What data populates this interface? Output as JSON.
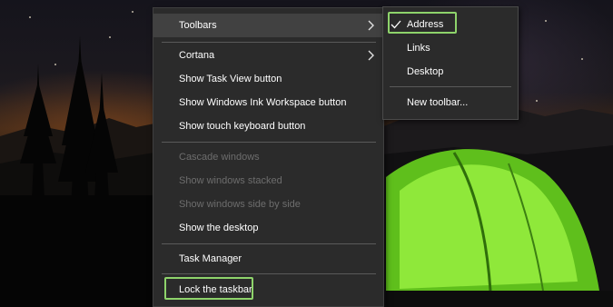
{
  "context_menu": {
    "items": [
      {
        "label": "Toolbars",
        "state": "highlighted",
        "has_submenu": true
      },
      {
        "label": "Cortana",
        "state": "normal",
        "has_submenu": true
      },
      {
        "label": "Show Task View button",
        "state": "normal"
      },
      {
        "label": "Show Windows Ink Workspace button",
        "state": "normal"
      },
      {
        "label": "Show touch keyboard button",
        "state": "normal"
      },
      {
        "label": "Cascade windows",
        "state": "disabled"
      },
      {
        "label": "Show windows stacked",
        "state": "disabled"
      },
      {
        "label": "Show windows side by side",
        "state": "disabled"
      },
      {
        "label": "Show the desktop",
        "state": "normal"
      },
      {
        "label": "Task Manager",
        "state": "normal"
      },
      {
        "label": "Lock the taskbar",
        "state": "normal",
        "outlined": true
      }
    ]
  },
  "toolbars_submenu": {
    "items": [
      {
        "label": "Address",
        "checked": true,
        "outlined": true
      },
      {
        "label": "Links",
        "checked": false
      },
      {
        "label": "Desktop",
        "checked": false
      },
      {
        "label": "New toolbar...",
        "checked": false
      }
    ]
  },
  "icons": {
    "submenu_arrow": "chevron-right-icon",
    "check": "checkmark-icon"
  },
  "colors": {
    "menu_background": "#2b2b2b",
    "hover_background": "#414141",
    "disabled_text": "#6d6d6d",
    "outline_accent": "#8ed36b",
    "tent_green": "#7ddc2a"
  }
}
